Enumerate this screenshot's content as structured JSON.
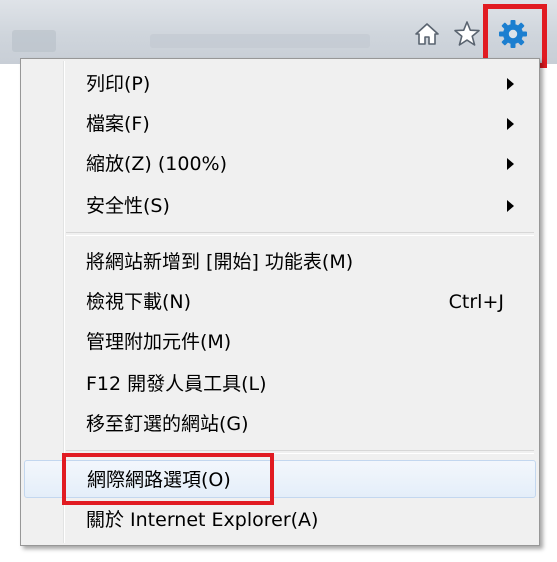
{
  "toolbar": {
    "buttons": [
      {
        "name": "home",
        "icon": "home-icon"
      },
      {
        "name": "favorites",
        "icon": "star-icon"
      },
      {
        "name": "tools",
        "icon": "gear-icon"
      }
    ],
    "tools_icon_color": "#1c7fd0"
  },
  "menu": {
    "items": [
      {
        "label": "列印(P)",
        "submenu": true
      },
      {
        "label": "檔案(F)",
        "submenu": true
      },
      {
        "label": "縮放(Z) (100%)",
        "submenu": true
      },
      {
        "label": "安全性(S)",
        "submenu": true
      },
      {
        "label": "將網站新增到 [開始] 功能表(M)",
        "submenu": false
      },
      {
        "label": "檢視下載(N)",
        "shortcut": "Ctrl+J",
        "submenu": false
      },
      {
        "label": "管理附加元件(M)",
        "submenu": false
      },
      {
        "label": "F12 開發人員工具(L)",
        "submenu": false
      },
      {
        "label": "移至釘選的網站(G)",
        "submenu": false
      },
      {
        "label": "網際網路選項(O)",
        "submenu": false,
        "highlighted": true
      },
      {
        "label": "關於 Internet Explorer(A)",
        "submenu": false
      }
    ]
  },
  "annotation_color": "#e11b22"
}
